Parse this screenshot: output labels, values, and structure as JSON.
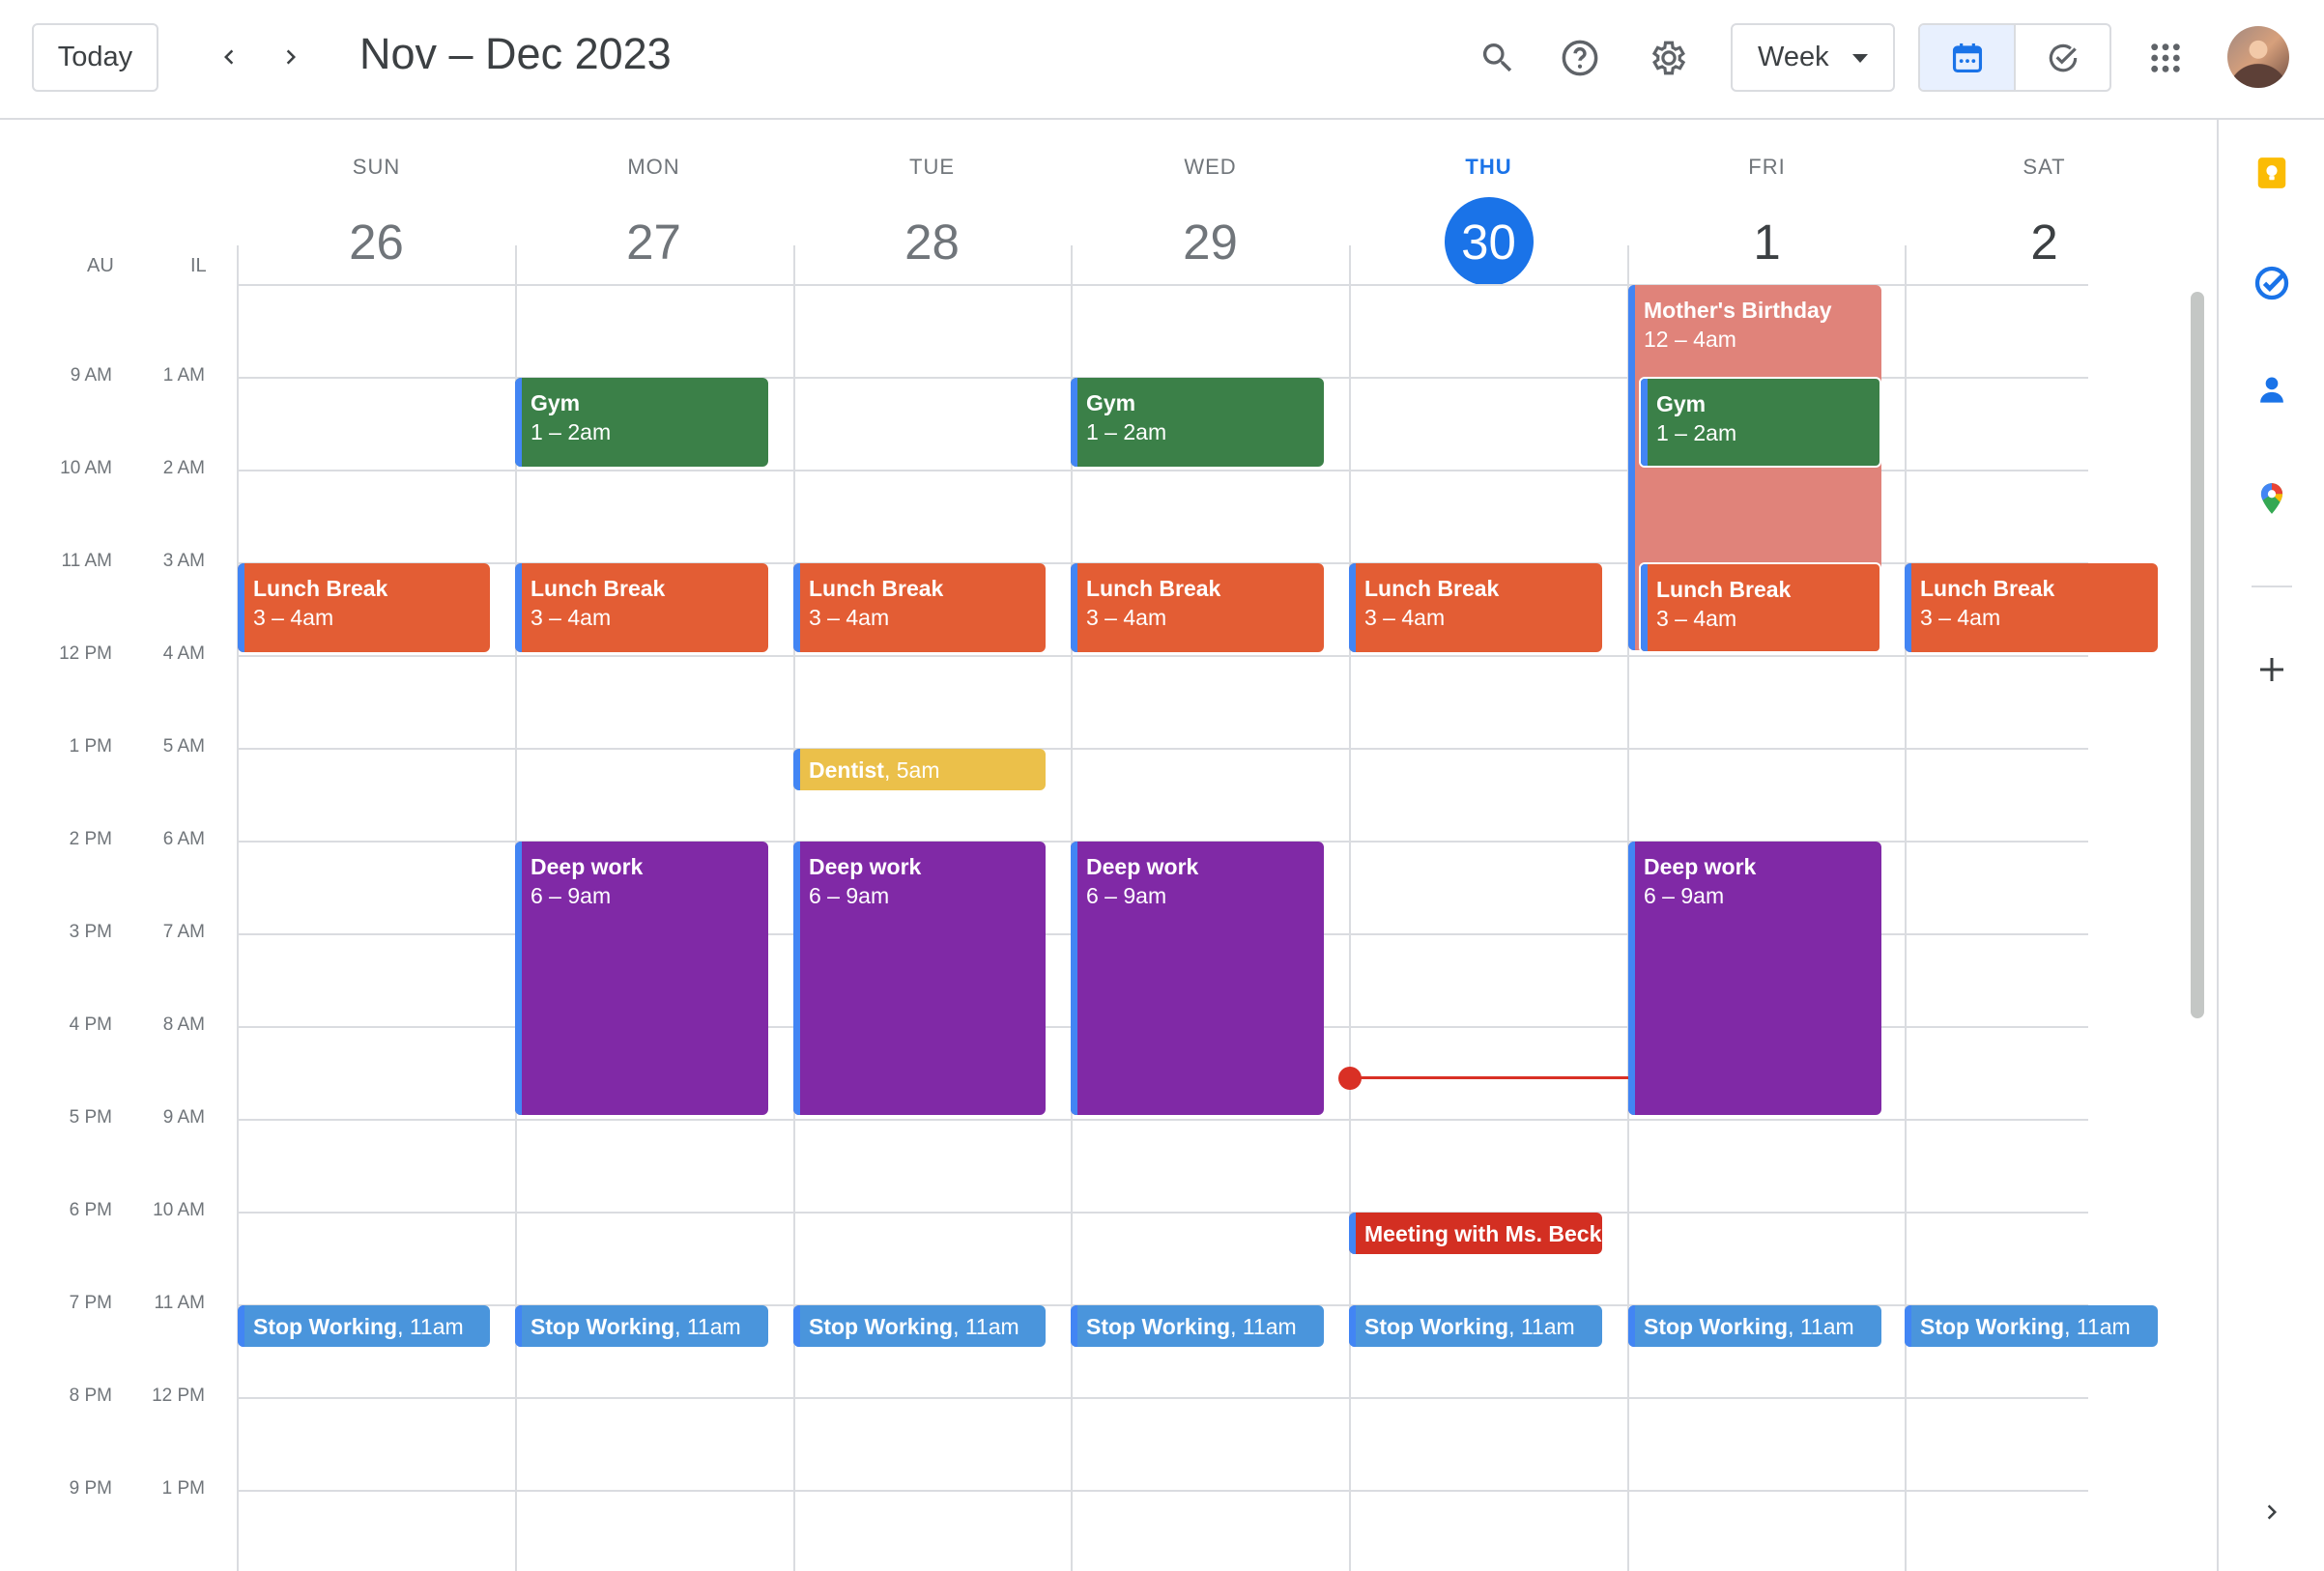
{
  "header": {
    "today_label": "Today",
    "title": "Nov – Dec 2023",
    "view_label": "Week",
    "icons": [
      "chevron-left-icon",
      "chevron-right-icon",
      "search-icon",
      "help-icon",
      "gear-icon",
      "calendar-icon",
      "tasks-check-icon",
      "apps-grid-icon"
    ]
  },
  "timezones": {
    "primary": "AU",
    "secondary": "IL"
  },
  "days": [
    {
      "dow": "SUN",
      "num": "26"
    },
    {
      "dow": "MON",
      "num": "27"
    },
    {
      "dow": "TUE",
      "num": "28"
    },
    {
      "dow": "WED",
      "num": "29"
    },
    {
      "dow": "THU",
      "num": "30",
      "today": true
    },
    {
      "dow": "FRI",
      "num": "1"
    },
    {
      "dow": "SAT",
      "num": "2"
    }
  ],
  "times": {
    "primary": [
      "9 AM",
      "10 AM",
      "11 AM",
      "12 PM",
      "1 PM",
      "2 PM",
      "3 PM",
      "4 PM",
      "5 PM",
      "6 PM",
      "7 PM",
      "8 PM",
      "9 PM"
    ],
    "secondary": [
      "1 AM",
      "2 AM",
      "3 AM",
      "4 AM",
      "5 AM",
      "6 AM",
      "7 AM",
      "8 AM",
      "9 AM",
      "10 AM",
      "11 AM",
      "12 PM",
      "1 PM"
    ]
  },
  "events": {
    "birthday": {
      "title": "Mother's Birthday",
      "time": "12 – 4am"
    },
    "gym": [
      {
        "title": "Gym",
        "time": "1 – 2am"
      },
      {
        "title": "Gym",
        "time": "1 – 2am"
      },
      {
        "title": "Gym",
        "time": "1 – 2am"
      }
    ],
    "lunch": [
      {
        "title": "Lunch Break",
        "time": "3 – 4am"
      },
      {
        "title": "Lunch Break",
        "time": "3 – 4am"
      },
      {
        "title": "Lunch Break",
        "time": "3 – 4am"
      },
      {
        "title": "Lunch Break",
        "time": "3 – 4am"
      },
      {
        "title": "Lunch Break",
        "time": "3 – 4am"
      },
      {
        "title": "Lunch Break",
        "time": "3 – 4am"
      },
      {
        "title": "Lunch Break",
        "time": "3 – 4am"
      }
    ],
    "dentist": {
      "title": "Dentist",
      "time": ", 5am"
    },
    "deep_work": [
      {
        "title": "Deep work",
        "time": "6 – 9am"
      },
      {
        "title": "Deep work",
        "time": "6 – 9am"
      },
      {
        "title": "Deep work",
        "time": "6 – 9am"
      },
      {
        "title": "Deep work",
        "time": "6 – 9am"
      }
    ],
    "meeting": {
      "title": "Meeting with Ms. Beck"
    },
    "stop_working": [
      {
        "title": "Stop Working",
        "time": ", 11am"
      },
      {
        "title": "Stop Working",
        "time": ", 11am"
      },
      {
        "title": "Stop Working",
        "time": ", 11am"
      },
      {
        "title": "Stop Working",
        "time": ", 11am"
      },
      {
        "title": "Stop Working",
        "time": ", 11am"
      },
      {
        "title": "Stop Working",
        "time": ", 11am"
      },
      {
        "title": "Stop Working",
        "time": ", 11am"
      }
    ]
  },
  "side_panel": {
    "icons": [
      "keep-icon",
      "tasks-icon",
      "contacts-icon",
      "maps-icon",
      "add-icon",
      "chevron-right-icon"
    ]
  },
  "colors": {
    "lunch": "#e35d34",
    "gym": "#3b8048",
    "deep_work": "#8029a6",
    "stop_working": "#4a95dc",
    "dentist": "#ebc04a",
    "meeting": "#d32f22",
    "birthday": "#e0837a",
    "today": "#1a73e8",
    "now_indicator": "#d93025"
  }
}
